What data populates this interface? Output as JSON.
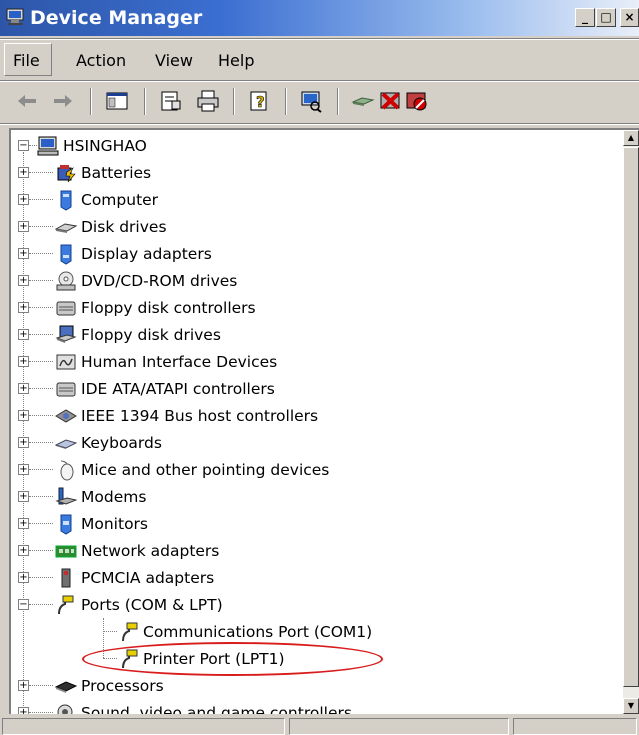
{
  "window": {
    "title": "Device Manager"
  },
  "window_buttons": [
    "_",
    "□",
    "×"
  ],
  "menu": [
    "File",
    "Action",
    "View",
    "Help"
  ],
  "toolbar": [
    "back-arrow-icon",
    "forward-arrow-icon",
    "console-tree-icon",
    "properties-icon",
    "print-icon",
    "help-icon",
    "scan-hardware-icon",
    "update-driver-icon",
    "uninstall-icon",
    "disable-icon"
  ],
  "tree": {
    "root": "HSINGHAO",
    "categories": [
      {
        "label": "Batteries",
        "icon": "battery-icon"
      },
      {
        "label": "Computer",
        "icon": "computer-icon"
      },
      {
        "label": "Disk drives",
        "icon": "disk-drive-icon"
      },
      {
        "label": "Display adapters",
        "icon": "display-adapter-icon"
      },
      {
        "label": "DVD/CD-ROM drives",
        "icon": "cdrom-icon"
      },
      {
        "label": "Floppy disk controllers",
        "icon": "controller-icon"
      },
      {
        "label": "Floppy disk drives",
        "icon": "floppy-icon"
      },
      {
        "label": "Human Interface Devices",
        "icon": "hid-icon"
      },
      {
        "label": "IDE ATA/ATAPI controllers",
        "icon": "controller-icon"
      },
      {
        "label": "IEEE 1394 Bus host controllers",
        "icon": "firewire-icon"
      },
      {
        "label": "Keyboards",
        "icon": "keyboard-icon"
      },
      {
        "label": "Mice and other pointing devices",
        "icon": "mouse-icon"
      },
      {
        "label": "Modems",
        "icon": "modem-icon"
      },
      {
        "label": "Monitors",
        "icon": "monitor-icon"
      },
      {
        "label": "Network adapters",
        "icon": "network-icon"
      },
      {
        "label": "PCMCIA adapters",
        "icon": "pcmcia-icon"
      },
      {
        "label": "Ports (COM & LPT)",
        "icon": "port-icon",
        "expanded": true,
        "children": [
          {
            "label": "Communications Port (COM1)",
            "icon": "port-icon"
          },
          {
            "label": "Printer Port (LPT1)",
            "icon": "port-icon",
            "highlighted": true
          }
        ]
      },
      {
        "label": "Processors",
        "icon": "processor-icon"
      },
      {
        "label": "Sound, video and game controllers",
        "icon": "sound-icon"
      }
    ]
  },
  "colors": {
    "highlight_ellipse": "#d81c1c",
    "title_bar": "#2d56a8"
  }
}
